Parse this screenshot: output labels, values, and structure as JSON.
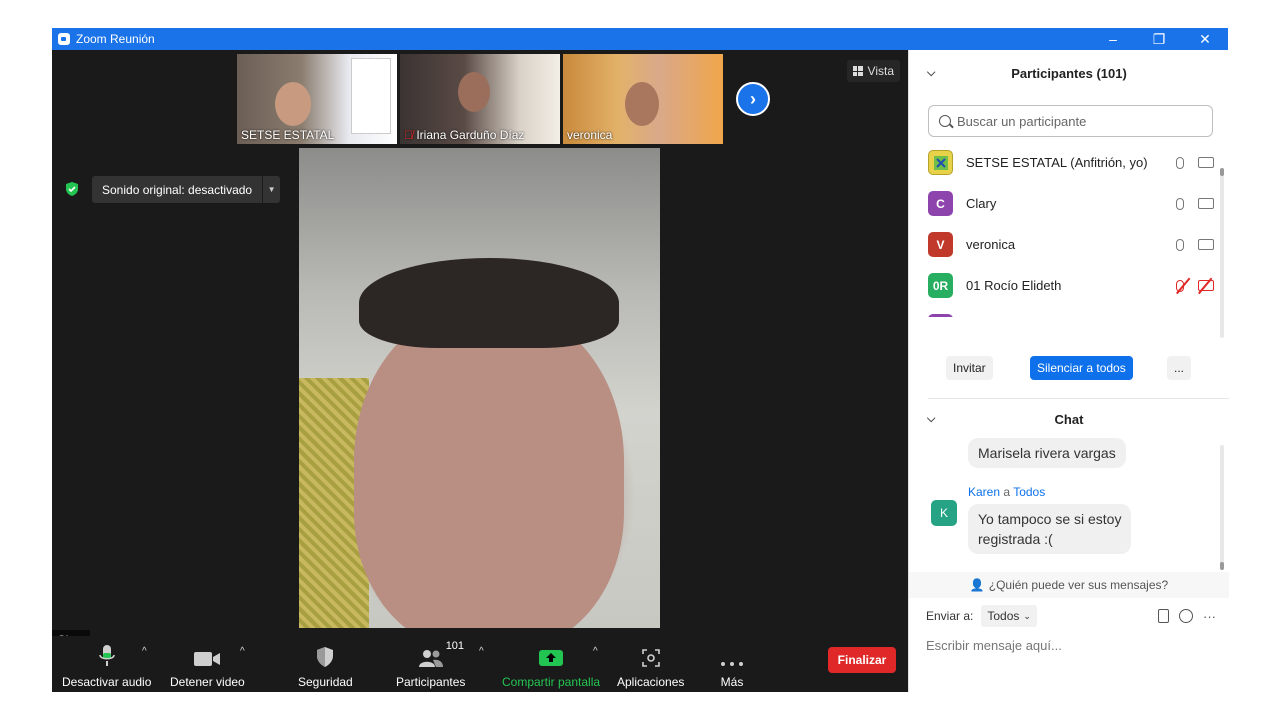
{
  "window": {
    "title": "Zoom Reunión",
    "controls": [
      "–",
      "❐",
      "✕"
    ]
  },
  "thumbnails": [
    {
      "name": "SETSE ESTATAL",
      "muted": false
    },
    {
      "name": "Iriana Garduño Díaz",
      "muted": true
    },
    {
      "name": "veronica",
      "muted": false
    }
  ],
  "view_button": "Vista",
  "original_sound": {
    "label": "Sonido original: desactivado"
  },
  "active_speaker": "Clary",
  "toolbar": {
    "mute_audio": "Desactivar audio",
    "stop_video": "Detener video",
    "security": "Seguridad",
    "participants": "Participantes",
    "participants_count": "101",
    "share_screen": "Compartir pantalla",
    "apps": "Aplicaciones",
    "more": "Más",
    "end": "Finalizar"
  },
  "participants_panel": {
    "title": "Participantes (101)",
    "search_placeholder": "Buscar un participante",
    "list": [
      {
        "initials": "",
        "name": "SETSE ESTATAL (Anfitrión, yo)",
        "color": "#e8d24a",
        "muted": false
      },
      {
        "initials": "C",
        "name": "Clary",
        "color": "#8e44ad",
        "muted": false
      },
      {
        "initials": "V",
        "name": "veronica",
        "color": "#c0392b",
        "muted": false
      },
      {
        "initials": "0R",
        "name": "01 Rocío Elideth",
        "color": "#27ae60",
        "muted": true
      }
    ],
    "invite": "Invitar",
    "mute_all": "Silenciar a todos",
    "more": "..."
  },
  "chat": {
    "title": "Chat",
    "messages": [
      {
        "text": "Marisela rivera vargas"
      },
      {
        "sender": "Karen",
        "to_word": "a",
        "to": "Todos",
        "avatar": "K",
        "text_line1": "Yo tampoco se si estoy",
        "text_line2": "registrada :("
      }
    ],
    "who_can_see": "¿Quién puede ver sus mensajes?",
    "send_to_label": "Enviar a:",
    "send_to_value": "Todos",
    "input_placeholder": "Escribir mensaje aquí..."
  }
}
